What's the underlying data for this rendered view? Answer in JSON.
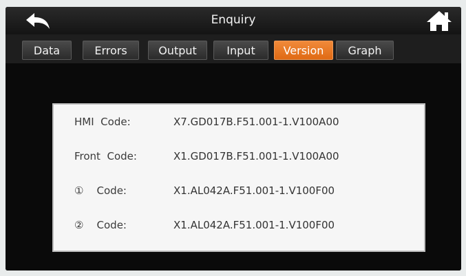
{
  "header": {
    "title": "Enquiry",
    "back_icon": "back-arrow-icon",
    "home_icon": "home-icon"
  },
  "tabs": [
    {
      "label": "Data",
      "active": false
    },
    {
      "label": "Errors",
      "active": false
    },
    {
      "label": "Output",
      "active": false
    },
    {
      "label": "Input",
      "active": false
    },
    {
      "label": "Version",
      "active": true
    },
    {
      "label": "Graph",
      "active": false
    }
  ],
  "versions": [
    {
      "label": "HMI  Code:",
      "value": "X7.GD017B.F51.001-1.V100A00"
    },
    {
      "label": "Front  Code:",
      "value": "X1.GD017B.F51.001-1.V100A00"
    },
    {
      "label": "①    Code:",
      "value": "X1.AL042A.F51.001-1.V100F00"
    },
    {
      "label": "②    Code:",
      "value": "X1.AL042A.F51.001-1.V100F00"
    }
  ],
  "colors": {
    "active_tab": "#e8751f",
    "screen_bg": "#0c0c0c",
    "panel_bg": "#f6f6f6"
  }
}
